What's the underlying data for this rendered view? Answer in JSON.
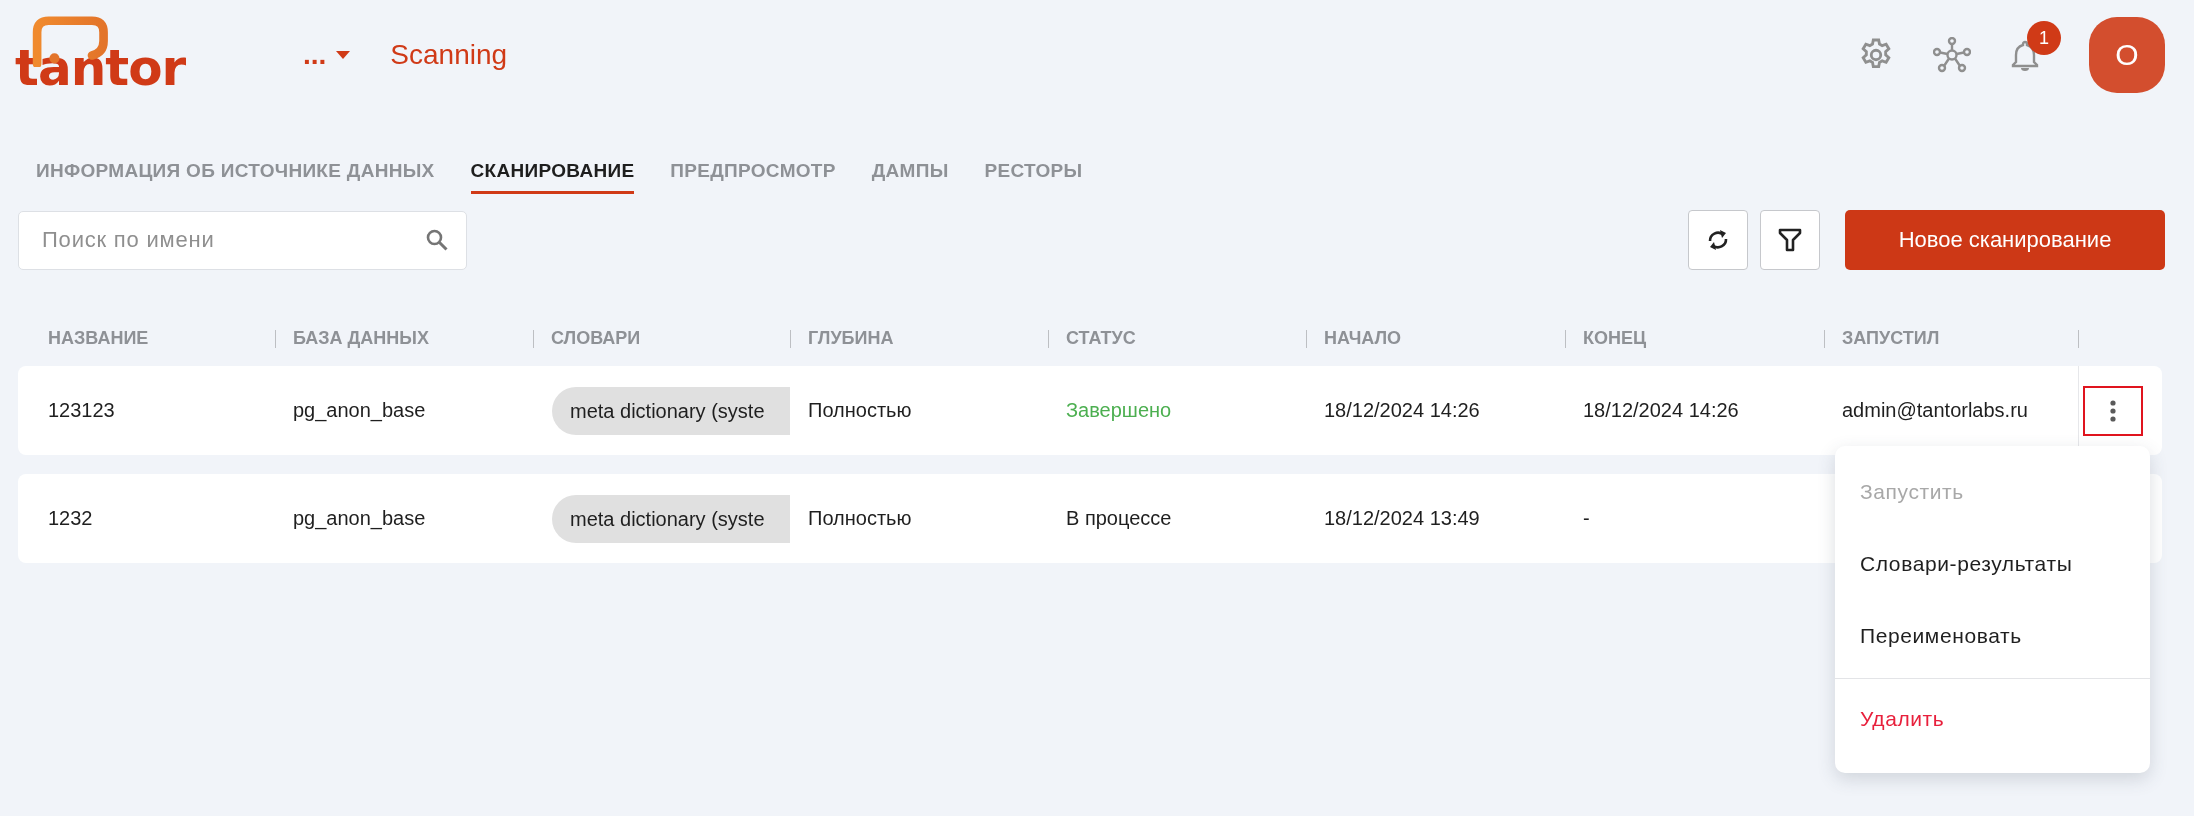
{
  "header": {
    "logo": "tantor",
    "breadcrumb": "...",
    "title": "Scanning",
    "notifications_badge": "1",
    "avatar": "O"
  },
  "tabs": [
    {
      "label": "ИНФОРМАЦИЯ ОБ ИСТОЧНИКЕ ДАННЫХ",
      "selected": false
    },
    {
      "label": "СКАНИРОВАНИЕ",
      "selected": true
    },
    {
      "label": "ПРЕДПРОСМОТР",
      "selected": false
    },
    {
      "label": "ДАМПЫ",
      "selected": false
    },
    {
      "label": "РЕСТОРЫ",
      "selected": false
    }
  ],
  "search": {
    "placeholder": "Поиск по имени"
  },
  "new_button": "Новое сканирование",
  "table": {
    "columns": [
      "НАЗВАНИЕ",
      "БАЗА ДАННЫХ",
      "СЛОВАРИ",
      "ГЛУБИНА",
      "СТАТУС",
      "НАЧАЛО",
      "КОНЕЦ",
      "ЗАПУСТИЛ"
    ],
    "rows": [
      {
        "name": "123123",
        "database": "pg_anon_base",
        "dictionary": "meta dictionary (syste",
        "depth": "Полностью",
        "status": "Завершено",
        "color": "#4caf50",
        "start": "18/12/2024 14:26",
        "end": "18/12/2024 14:26",
        "started_by": "admin@tantorlabs.ru",
        "menu_open": true
      },
      {
        "name": "1232",
        "database": "pg_anon_base",
        "dictionary": "meta dictionary (syste",
        "depth": "Полностью",
        "status": "В процессе",
        "color": "#1f1f1f",
        "start": "18/12/2024 13:49",
        "end": "-"
      }
    ]
  },
  "row_menu": {
    "items": [
      {
        "label": "Запустить",
        "kind": "normal",
        "disabled": true
      },
      {
        "label": "Словари-результаты",
        "kind": "normal",
        "disabled": false
      },
      {
        "label": "Переименовать",
        "kind": "normal",
        "disabled": false
      },
      {
        "label": "Удалить",
        "kind": "danger",
        "disabled": false
      }
    ]
  }
}
